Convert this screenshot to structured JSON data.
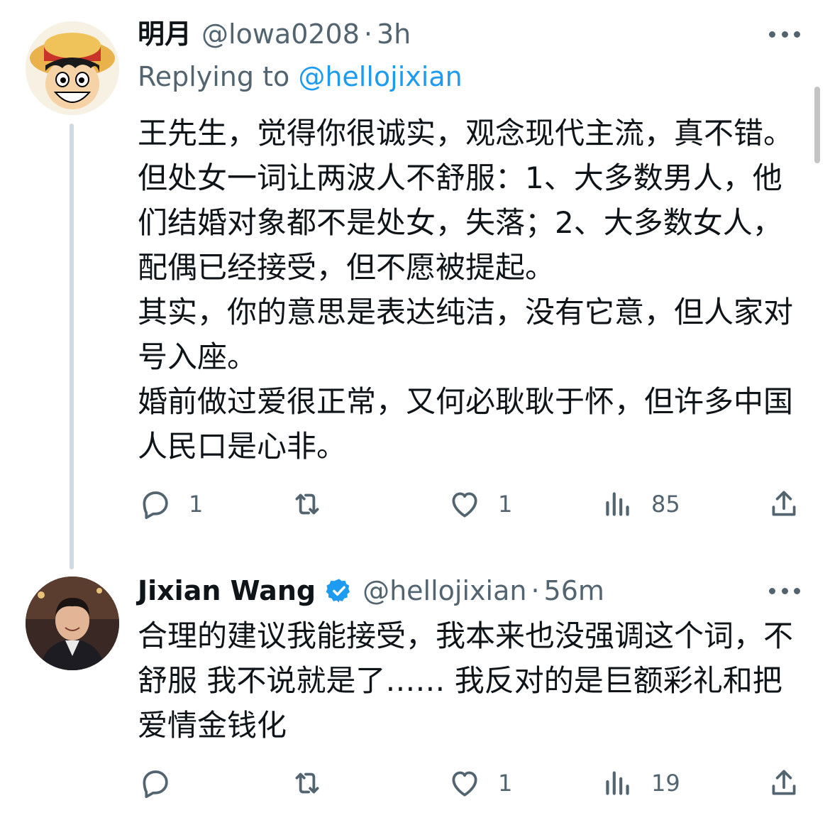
{
  "tweets": [
    {
      "author_name": "明月",
      "handle": "@lowa0208",
      "separator": "·",
      "time": "3h",
      "replying_prefix": "Replying to",
      "replying_handle": "@hellojixian",
      "paragraphs": [
        "王先生，觉得你很诚实，观念现代主流，真不错。但处女一词让两波人不舒服：1、大多数男人，他们结婚对象都不是处女，失落；2、大多数女人，配偶已经接受，但不愿被提起。",
        "其实，你的意思是表达纯洁，没有它意，但人家对号入座。",
        "婚前做过爱很正常，又何必耿耿于怀，但许多中国人民口是心非。"
      ],
      "actions": {
        "replies": "1",
        "retweets": "",
        "likes": "1",
        "views": "85"
      },
      "avatar_icon": "luffy-avatar"
    },
    {
      "author_name": "Jixian Wang",
      "verified": true,
      "handle": "@hellojixian",
      "separator": "·",
      "time": "56m",
      "paragraphs": [
        "合理的建议我能接受，我本来也没强调这个词，不舒服 我不说就是了…… 我反对的是巨额彩礼和把爱情金钱化"
      ],
      "actions": {
        "replies": "",
        "retweets": "",
        "likes": "1",
        "views": "19"
      },
      "avatar_icon": "person-avatar"
    }
  ],
  "colors": {
    "text": "#0f1419",
    "secondary": "#536471",
    "accent": "#1d9bf0",
    "thread_line": "#cfd9de"
  },
  "icons": [
    "reply-icon",
    "retweet-icon",
    "like-icon",
    "views-icon",
    "share-icon",
    "more-icon",
    "verified-icon"
  ]
}
